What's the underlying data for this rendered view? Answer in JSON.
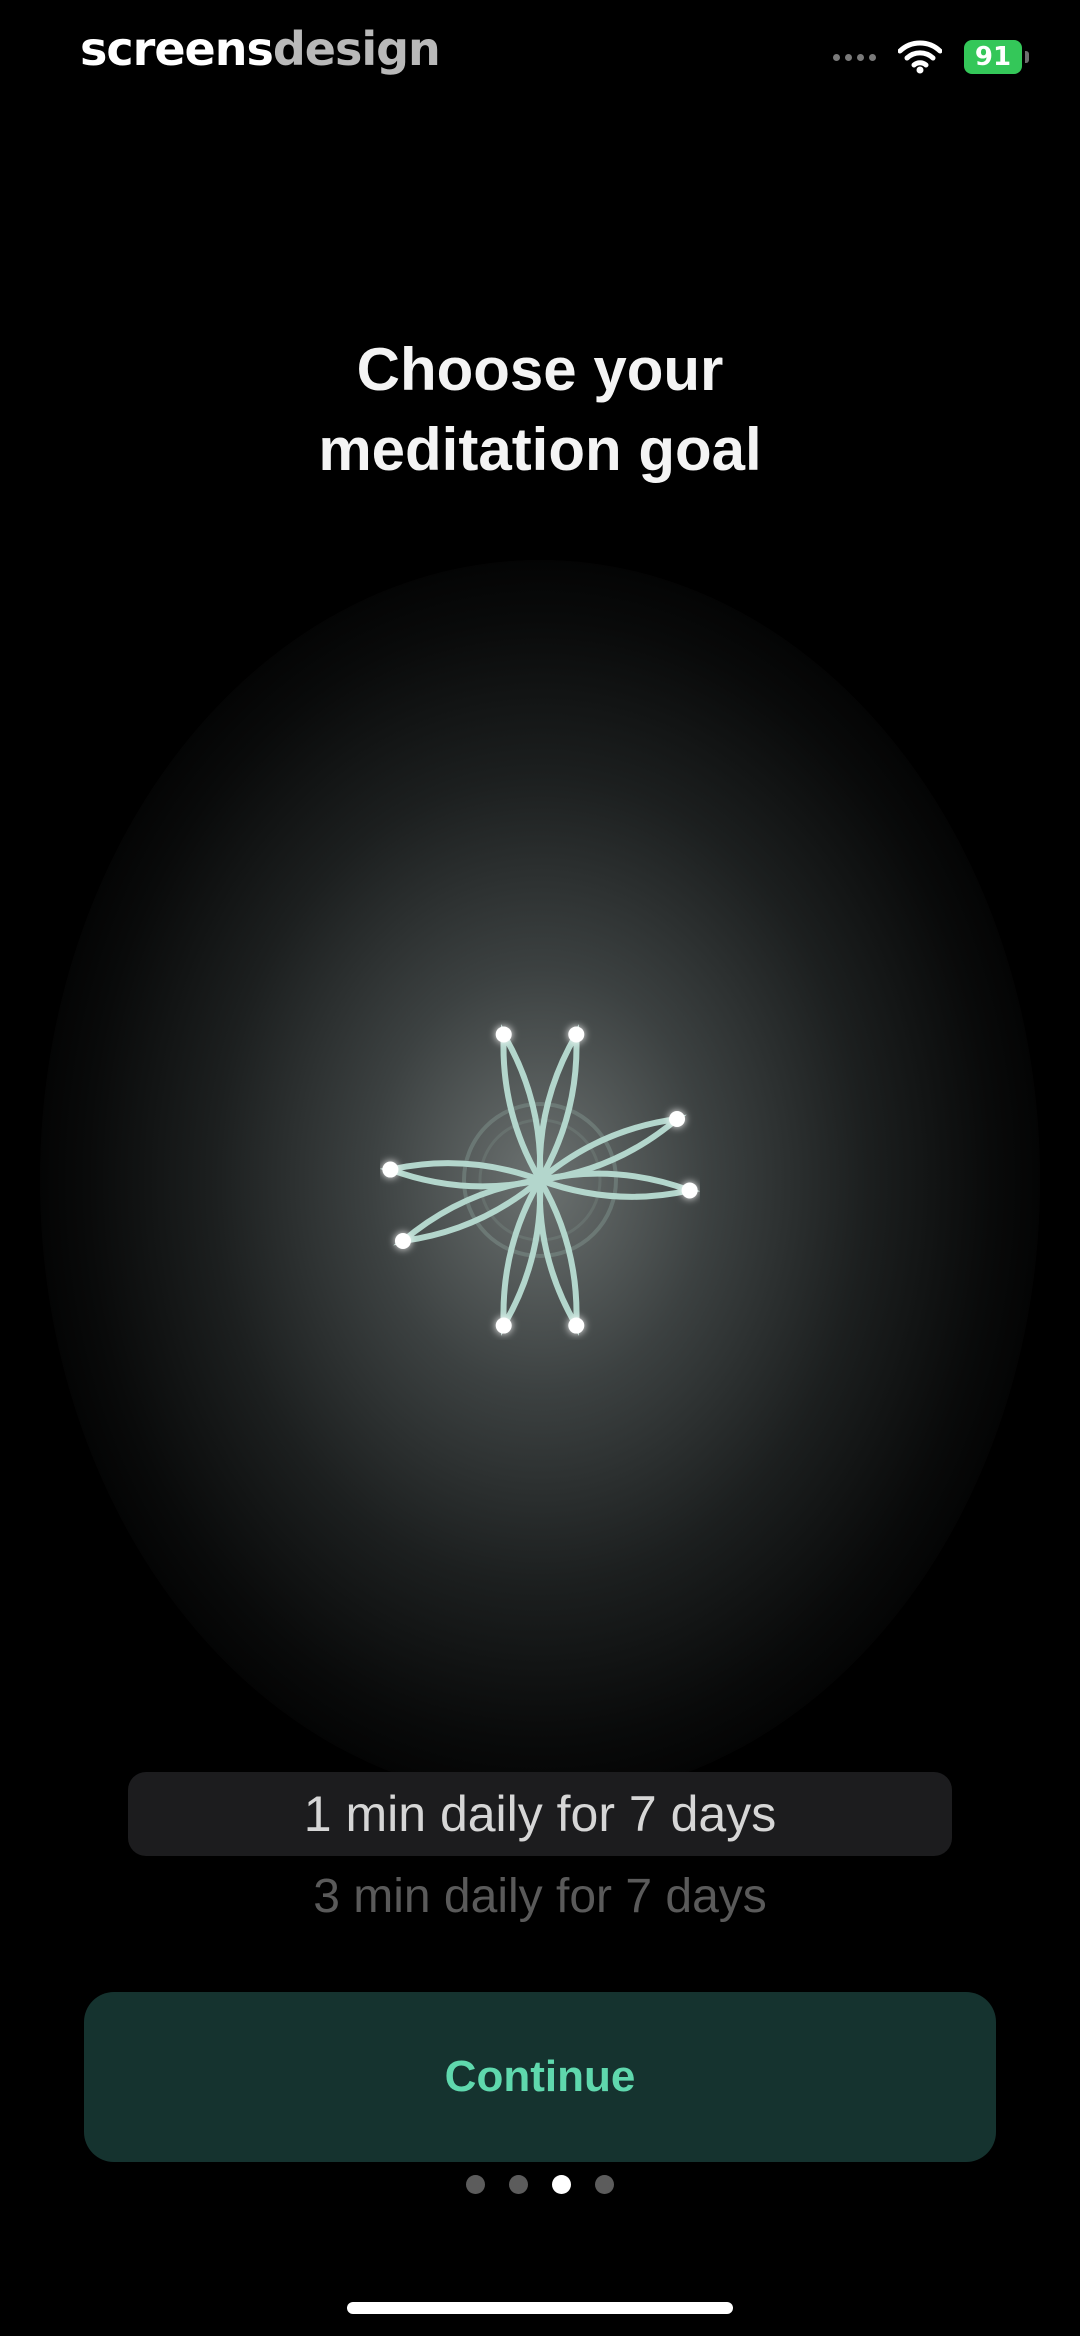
{
  "watermark": {
    "part1": "screens",
    "part2": "design"
  },
  "status_bar": {
    "battery": "91"
  },
  "title": {
    "line1": "Choose your",
    "line2": "meditation goal"
  },
  "picker": {
    "selected": "1 min daily for 7 days",
    "next": "3 min daily for 7 days"
  },
  "continue_label": "Continue",
  "pagination": {
    "total": 4,
    "current": 3
  },
  "colors": {
    "accent_text": "#5fd8ad",
    "button_bg": "#15332f",
    "flower_stroke": "#b3d6cc",
    "battery": "#34c759"
  }
}
